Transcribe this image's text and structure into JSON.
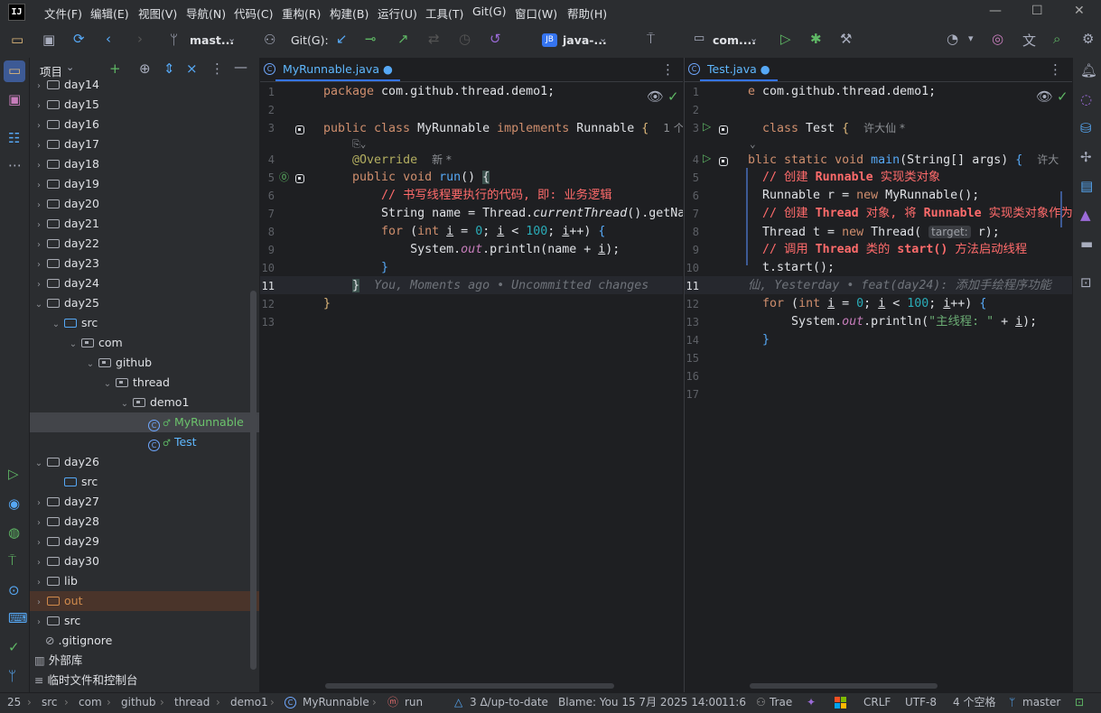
{
  "app": {
    "logo": "IJ"
  },
  "menu": [
    "文件(F)",
    "编辑(E)",
    "视图(V)",
    "导航(N)",
    "代码(C)",
    "重构(R)",
    "构建(B)",
    "运行(U)",
    "工具(T)",
    "Git(G)",
    "窗口(W)",
    "帮助(H)"
  ],
  "toolbar": {
    "branch": "mast...",
    "git_label": "Git(G):",
    "project_badge": "JB",
    "project_name": "java-...",
    "run_config": "com...."
  },
  "project_panel": {
    "title": "项目",
    "tree": [
      {
        "label": "day14",
        "depth": 0,
        "kind": "folder",
        "expanded": false
      },
      {
        "label": "day15",
        "depth": 0,
        "kind": "folder",
        "expanded": false
      },
      {
        "label": "day16",
        "depth": 0,
        "kind": "folder",
        "expanded": false
      },
      {
        "label": "day17",
        "depth": 0,
        "kind": "folder",
        "expanded": false
      },
      {
        "label": "day18",
        "depth": 0,
        "kind": "folder",
        "expanded": false
      },
      {
        "label": "day19",
        "depth": 0,
        "kind": "folder",
        "expanded": false
      },
      {
        "label": "day20",
        "depth": 0,
        "kind": "folder",
        "expanded": false
      },
      {
        "label": "day21",
        "depth": 0,
        "kind": "folder",
        "expanded": false
      },
      {
        "label": "day22",
        "depth": 0,
        "kind": "folder",
        "expanded": false
      },
      {
        "label": "day23",
        "depth": 0,
        "kind": "folder",
        "expanded": false
      },
      {
        "label": "day24",
        "depth": 0,
        "kind": "folder",
        "expanded": false
      },
      {
        "label": "day25",
        "depth": 0,
        "kind": "folder",
        "expanded": true
      },
      {
        "label": "src",
        "depth": 1,
        "kind": "src",
        "expanded": true
      },
      {
        "label": "com",
        "depth": 2,
        "kind": "pkg",
        "expanded": true
      },
      {
        "label": "github",
        "depth": 3,
        "kind": "pkg",
        "expanded": true
      },
      {
        "label": "thread",
        "depth": 4,
        "kind": "pkg",
        "expanded": true
      },
      {
        "label": "demo1",
        "depth": 5,
        "kind": "pkg",
        "expanded": true
      },
      {
        "label": "MyRunnable",
        "depth": 6,
        "kind": "java-modified",
        "selected": true
      },
      {
        "label": "Test",
        "depth": 6,
        "kind": "java"
      },
      {
        "label": "day26",
        "depth": 0,
        "kind": "folder",
        "expanded": true
      },
      {
        "label": "src",
        "depth": 1,
        "kind": "src"
      },
      {
        "label": "day27",
        "depth": 0,
        "kind": "folder",
        "expanded": false
      },
      {
        "label": "day28",
        "depth": 0,
        "kind": "folder",
        "expanded": false
      },
      {
        "label": "day29",
        "depth": 0,
        "kind": "folder",
        "expanded": false
      },
      {
        "label": "day30",
        "depth": 0,
        "kind": "folder",
        "expanded": false
      },
      {
        "label": "lib",
        "depth": 0,
        "kind": "folder",
        "expanded": false
      },
      {
        "label": "out",
        "depth": 0,
        "kind": "out",
        "expanded": false
      },
      {
        "label": "src",
        "depth": 0,
        "kind": "folder",
        "expanded": false
      },
      {
        "label": ".gitignore",
        "depth": 0,
        "kind": "ignore"
      },
      {
        "label": "外部库",
        "depth": -1,
        "kind": "lib"
      },
      {
        "label": "临时文件和控制台",
        "depth": -1,
        "kind": "scratch"
      }
    ]
  },
  "editor_left": {
    "tab": "MyRunnable.java",
    "line_numbers": [
      "1",
      "2",
      "3",
      "",
      "4",
      "5",
      "6",
      "7",
      "8",
      "9",
      "10",
      "11",
      "12",
      "13"
    ],
    "hint_author_right": "1 个",
    "hint_new": "新 *",
    "blame_line": "You, Moments ago • Uncommitted changes"
  },
  "editor_right": {
    "tab": "Test.java",
    "line_numbers": [
      "1",
      "2",
      "3",
      "",
      "4",
      "5",
      "6",
      "7",
      "8",
      "9",
      "10",
      "11",
      "12",
      "13",
      "14",
      "15",
      "16",
      "17"
    ],
    "author_hint1": "许大仙 *",
    "author_hint2": "许大",
    "target_hint": "target:",
    "blame_line": "仙, Yesterday • feat(day24): 添加手绘程序功能"
  },
  "status_bar": {
    "breadcrumbs": [
      "25",
      "src",
      "com",
      "github",
      "thread",
      "demo1",
      "MyRunnable",
      "run"
    ],
    "vcs": "3 Δ/up-to-date",
    "blame": "Blame: You 15 7月 2025 14:00",
    "position": "11:6",
    "plugin": "Trae",
    "line_sep": "CRLF",
    "encoding": "UTF-8",
    "indent": "4 个空格",
    "branch": "master"
  }
}
